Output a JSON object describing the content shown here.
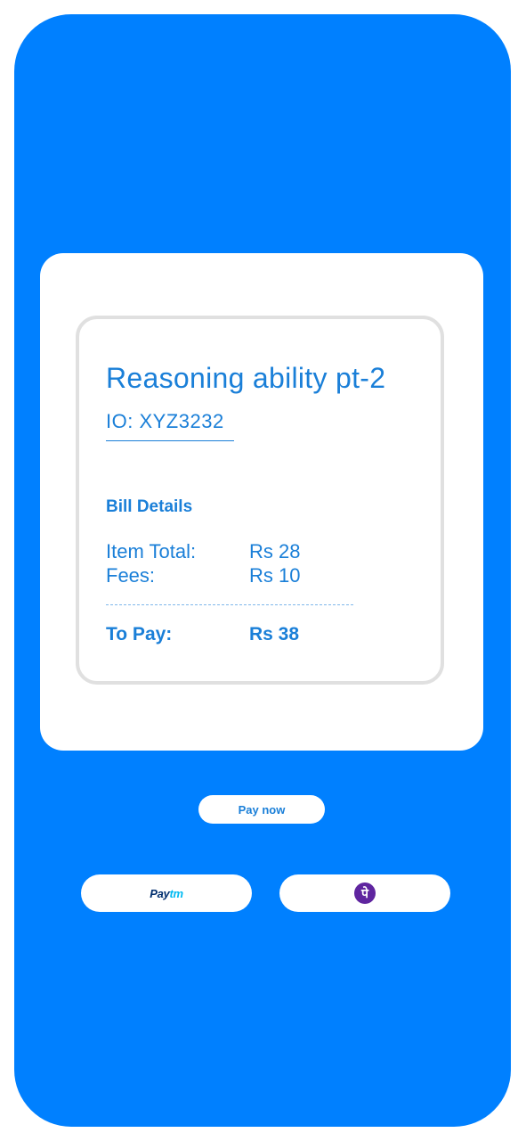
{
  "item": {
    "title": "Reasoning ability pt-2",
    "order_id": "IO: XYZ3232"
  },
  "bill": {
    "heading": "Bill Details",
    "item_total_label": "Item Total:",
    "item_total_value": "Rs 28",
    "fees_label": "Fees:",
    "fees_value": "Rs 10",
    "to_pay_label": "To Pay:",
    "to_pay_value": "Rs 38"
  },
  "actions": {
    "pay_now_label": "Pay now"
  },
  "payment_methods": {
    "paytm": {
      "logo_part1": "Pay",
      "logo_part2": "tm",
      "icon": "paytm-logo"
    },
    "phonepe": {
      "logo_glyph": "पे",
      "icon": "phonepe-logo"
    }
  },
  "colors": {
    "background": "#0080ff",
    "accent_text": "#1a7fd8",
    "card": "#ffffff",
    "receipt_border": "#e0e0e0",
    "paytm_dark": "#002e6e",
    "paytm_light": "#00baf2",
    "phonepe_purple": "#5f259f"
  }
}
